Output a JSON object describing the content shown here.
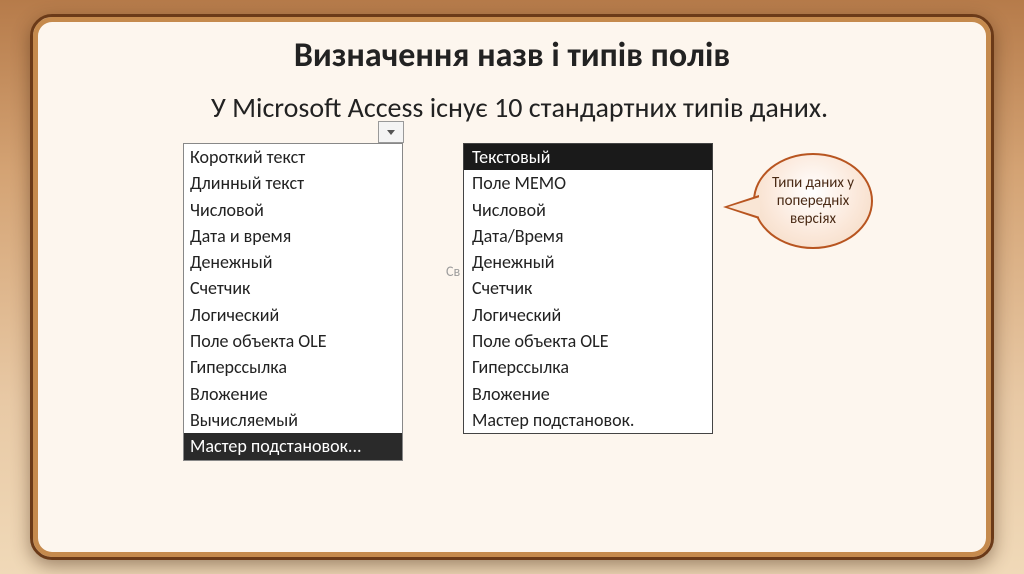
{
  "title": "Визначення назв і типів полів",
  "intro": "У Microsoft Access існує 10 стандартних типів даних.",
  "bg_hint": "Св",
  "list_left": {
    "items": [
      "Короткий текст",
      "Длинный текст",
      "Числовой",
      "Дата и время",
      "Денежный",
      "Счетчик",
      "Логический",
      "Поле объекта OLE",
      "Гиперссылка",
      "Вложение",
      "Вычисляемый",
      "Мастер подстановок..."
    ],
    "selected_index": 11
  },
  "list_right": {
    "header": "Текстовый",
    "items": [
      "Поле МЕМО",
      "Числовой",
      "Дата/Время",
      "Денежный",
      "Счетчик",
      "Логический",
      "Поле объекта OLE",
      "Гиперссылка",
      "Вложение",
      "Мастер подстановок."
    ]
  },
  "callout": "Типи даних у попередніх версіях"
}
